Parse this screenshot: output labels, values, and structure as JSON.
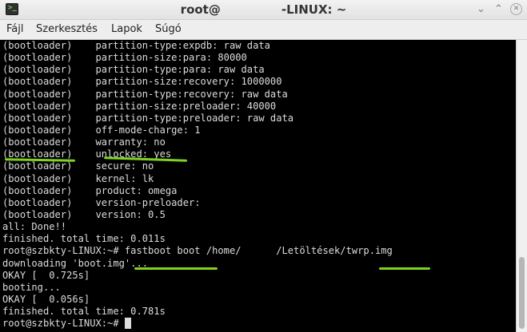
{
  "window": {
    "title_prefix": "root@",
    "title_suffix": "-LINUX: ~",
    "buttons": {
      "minimize": "⌄",
      "maximize": "⌃",
      "close": "✕"
    },
    "app_icon_glyph": ">_"
  },
  "menubar": [
    "Fájl",
    "Szerkesztés",
    "Lapok",
    "Súgó"
  ],
  "terminal": {
    "lines": [
      "(bootloader)    partition-type:expdb: raw data",
      "(bootloader)    partition-size:para: 80000",
      "(bootloader)    partition-type:para: raw data",
      "(bootloader)    partition-size:recovery: 1000000",
      "(bootloader)    partition-type:recovery: raw data",
      "(bootloader)    partition-size:preloader: 40000",
      "(bootloader)    partition-type:preloader: raw data",
      "(bootloader)    off-mode-charge: 1",
      "(bootloader)    warranty: no",
      "(bootloader)    unlocked: yes",
      "(bootloader)    secure: no",
      "(bootloader)    kernel: lk",
      "(bootloader)    product: omega",
      "(bootloader)    version-preloader:",
      "(bootloader)    version: 0.5",
      "all: Done!!",
      "finished. total time: 0.011s",
      "root@szbkty-LINUX:~# fastboot boot /home/      /Letöltések/twrp.img",
      "downloading 'boot.img'...",
      "OKAY [  0.725s]",
      "booting...",
      "OKAY [  0.056s]",
      "finished. total time: 0.781s",
      "root@szbkty-LINUX:~# "
    ]
  },
  "colors": {
    "terminal_bg": "#000000",
    "terminal_fg": "#dcdcdc",
    "highlight": "#7ed321",
    "titlebar": "#e8e8e8",
    "menubar": "#eeeeee"
  }
}
